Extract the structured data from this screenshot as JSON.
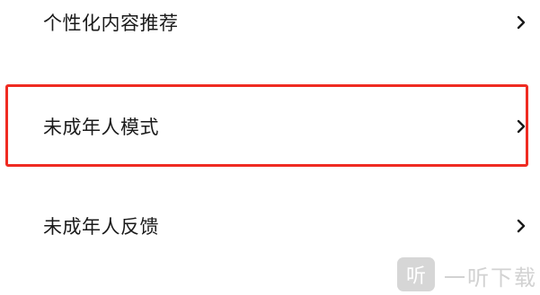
{
  "settings_list": {
    "items": [
      {
        "label": "个性化内容推荐"
      },
      {
        "label": "未成年人模式",
        "highlighted": true
      },
      {
        "label": "未成年人反馈"
      }
    ]
  },
  "annotation": {
    "highlight_color": "#ef2b22"
  },
  "watermark": {
    "logo_text": "听",
    "text": "一听下载"
  }
}
